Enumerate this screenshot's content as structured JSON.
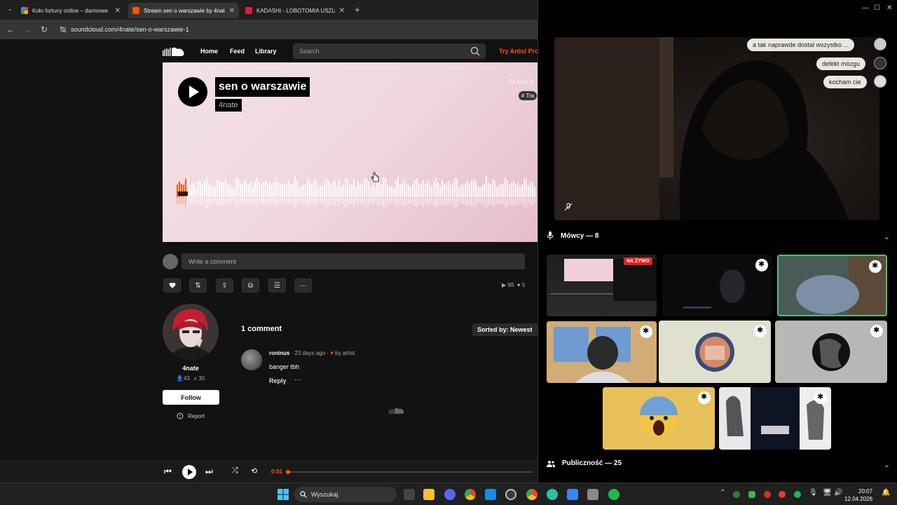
{
  "browser": {
    "tabs": [
      {
        "title": "Koło fortuny online – darmowe",
        "color": "#4a8df8",
        "active": false
      },
      {
        "title": "Stream sen o warszawie by 4nate",
        "color": "#ff5500",
        "active": true
      },
      {
        "title": "KADASHI - LOBOTOMIA USZU",
        "color": "#e01b3c",
        "active": false
      }
    ],
    "url": "soundcloud.com/4nate/sen-o-warszawie-1"
  },
  "soundcloud": {
    "nav": [
      "Home",
      "Feed",
      "Library"
    ],
    "search_placeholder": "Search",
    "try_artist": "Try Artist Pro",
    "track": {
      "title": "sen o warszawie",
      "artist": "4nate",
      "ago": "24 days a",
      "tag": "# Tra",
      "current_time": "0:01",
      "progress": 0.01
    },
    "comment_placeholder": "Write a comment",
    "stats": {
      "plays": "98",
      "likes": "5"
    },
    "artist": {
      "name": "4nate",
      "followers": "43",
      "tracks": "30",
      "follow_label": "Follow",
      "report_label": "Report"
    },
    "comments": {
      "count_label": "1 comment",
      "sort_label": "Sorted by: Newest",
      "items": [
        {
          "user": "roninus",
          "ago": "· 23 days ago ·",
          "by_artist": "by artist",
          "text": "banger tbh",
          "reply": "Reply"
        }
      ]
    },
    "player": {
      "time": "0:01"
    }
  },
  "discord": {
    "messages": [
      {
        "text": "a tak naprawde dostal wszystko ..."
      },
      {
        "text": "defekt mózgu"
      },
      {
        "text": "kocham cie"
      }
    ],
    "speakers_label": "Mówcy — 8",
    "live_badge": "NA ŻYWO",
    "audience_label": "Publiczność — 25"
  },
  "taskbar": {
    "search_label": "Wyszukaj",
    "time": "20:07",
    "date": "12.04.2026"
  },
  "colors": {
    "accent": "#ff5500",
    "bg": "#121212",
    "discord_bg": "#000000"
  }
}
